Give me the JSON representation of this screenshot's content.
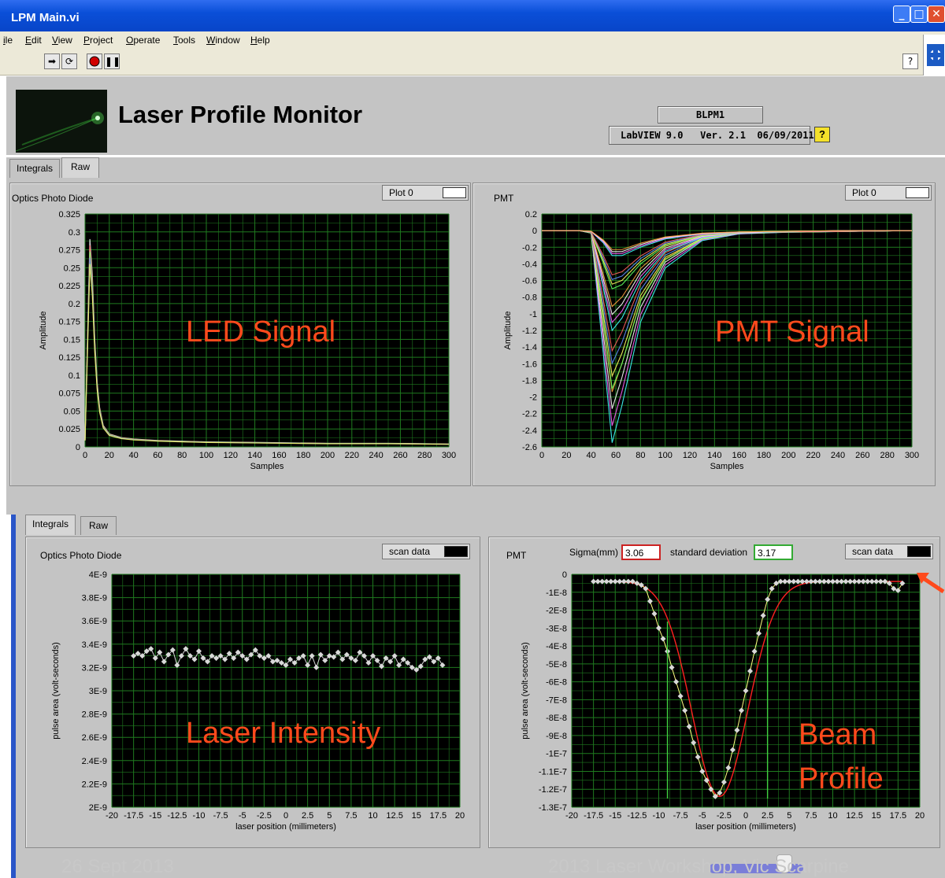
{
  "window": {
    "title": "LPM Main.vi"
  },
  "menu": [
    "ile",
    "Edit",
    "View",
    "Project",
    "Operate",
    "Tools",
    "Window",
    "Help"
  ],
  "toolbar": {
    "run_icon": "run-arrow-icon",
    "run_continuous_icon": "run-continuous-icon",
    "abort_icon": "abort-icon",
    "pause_icon": "pause-icon",
    "help_label": "?"
  },
  "header": {
    "title": "Laser Profile Monitor",
    "device": "BLPM1",
    "software": "LabVIEW 9.0",
    "version": "Ver. 2.1  06/09/2011",
    "help_label": "?"
  },
  "top_tabs": [
    "Integrals",
    "Raw"
  ],
  "top_active_tab": "Raw",
  "bottom_tabs": [
    "Integrals",
    "Raw"
  ],
  "bottom_active_tab": "Integrals",
  "overlays": {
    "led": "LED Signal",
    "pmt": "PMT Signal",
    "laser": "Laser Intensity",
    "beam1": "Beam",
    "beam2": "Profile"
  },
  "pmt_stats": {
    "sigma_label": "Sigma(mm)",
    "sigma_value": "3.06",
    "std_label": "standard deviation",
    "std_value": "3.17"
  },
  "footer": {
    "date": "26 Sept 2013",
    "event": "2013 Laser Workshop, Vic Scarpine"
  },
  "colors": {
    "plot_bg": "#000000",
    "grid": "#1f7a1f",
    "panel": "#c4c4c4",
    "overlay_text": "#ff4a1c",
    "fit_line": "#ff2020",
    "markers": "#d8d8d8",
    "sigma_border": "#cc2222",
    "std_border": "#33aa33",
    "cursor": "#40d040"
  },
  "chart_data": [
    {
      "type": "line",
      "title": "Optics Photo Diode",
      "legend": "Plot 0",
      "xlabel": "Samples",
      "ylabel": "Amplitude",
      "xlim": [
        0,
        300
      ],
      "ylim": [
        0,
        0.325
      ],
      "x_ticks": [
        "0",
        "20",
        "40",
        "60",
        "80",
        "100",
        "120",
        "140",
        "160",
        "180",
        "200",
        "220",
        "240",
        "260",
        "280",
        "300"
      ],
      "y_ticks": [
        "0",
        "0.025",
        "0.05",
        "0.075",
        "0.1",
        "0.125",
        "0.15",
        "0.175",
        "0.2",
        "0.225",
        "0.25",
        "0.275",
        "0.3",
        "0.325"
      ],
      "series": [
        {
          "x": [
            0,
            2,
            4,
            6,
            8,
            10,
            12,
            15,
            20,
            30,
            40,
            60,
            80,
            100,
            150,
            200,
            250,
            300
          ],
          "y": [
            0.01,
            0.15,
            0.29,
            0.24,
            0.15,
            0.09,
            0.055,
            0.03,
            0.018,
            0.013,
            0.011,
            0.009,
            0.008,
            0.007,
            0.006,
            0.005,
            0.005,
            0.004
          ]
        }
      ]
    },
    {
      "type": "line",
      "title": "PMT",
      "legend": "Plot 0",
      "xlabel": "Samples",
      "ylabel": "Amplitude",
      "xlim": [
        0,
        300
      ],
      "ylim": [
        -2.6,
        0.2
      ],
      "x_ticks": [
        "0",
        "20",
        "40",
        "60",
        "80",
        "100",
        "120",
        "140",
        "160",
        "180",
        "200",
        "220",
        "240",
        "260",
        "280",
        "300"
      ],
      "y_ticks": [
        "0.2",
        "0",
        "-0.2",
        "-0.4",
        "-0.6",
        "-0.8",
        "-1",
        "-1.2",
        "-1.4",
        "-1.6",
        "-1.8",
        "-2",
        "-2.2",
        "-2.4",
        "-2.6"
      ],
      "series": [
        {
          "x": [
            0,
            30,
            40,
            50,
            57,
            65,
            80,
            100,
            130,
            160,
            200,
            250,
            300
          ],
          "y": [
            0,
            0,
            -0.03,
            -1.5,
            -2.55,
            -2.1,
            -1.1,
            -0.45,
            -0.12,
            -0.04,
            -0.02,
            -0.01,
            0
          ]
        },
        {
          "x": [
            0,
            30,
            40,
            50,
            57,
            65,
            80,
            100,
            130,
            160,
            200,
            250,
            300
          ],
          "y": [
            0,
            0,
            -0.03,
            -1.1,
            -1.9,
            -1.6,
            -0.85,
            -0.35,
            -0.1,
            -0.03,
            -0.02,
            -0.01,
            0
          ]
        },
        {
          "x": [
            0,
            30,
            40,
            50,
            57,
            65,
            80,
            100,
            130,
            160,
            200,
            250,
            300
          ],
          "y": [
            0,
            0,
            -0.02,
            -0.7,
            -1.2,
            -1.05,
            -0.6,
            -0.25,
            -0.08,
            -0.03,
            -0.01,
            0,
            0
          ]
        },
        {
          "x": [
            0,
            30,
            40,
            50,
            57,
            65,
            80,
            100,
            130,
            160,
            200,
            250,
            300
          ],
          "y": [
            0,
            0,
            -0.02,
            -0.4,
            -0.7,
            -0.65,
            -0.4,
            -0.18,
            -0.06,
            -0.02,
            -0.01,
            0,
            0
          ]
        },
        {
          "x": [
            0,
            30,
            40,
            50,
            57,
            65,
            80,
            100,
            130,
            160,
            200,
            250,
            300
          ],
          "y": [
            0,
            0,
            -0.01,
            -0.15,
            -0.3,
            -0.3,
            -0.2,
            -0.1,
            -0.04,
            -0.02,
            -0.01,
            0,
            0
          ]
        }
      ]
    },
    {
      "type": "scatter",
      "title": "Optics Photo Diode",
      "legend": "scan data",
      "xlabel": "laser position (millimeters)",
      "ylabel": "pulse area (volt-seconds)",
      "xlim": [
        -20,
        20
      ],
      "ylim": [
        2e-09,
        4e-09
      ],
      "x_ticks": [
        "-20",
        "-17.5",
        "-15",
        "-12.5",
        "-10",
        "-7.5",
        "-5",
        "-2.5",
        "0",
        "2.5",
        "5",
        "7.5",
        "10",
        "12.5",
        "15",
        "17.5",
        "20"
      ],
      "y_ticks": [
        "2E-9",
        "2.2E-9",
        "2.4E-9",
        "2.6E-9",
        "2.8E-9",
        "3E-9",
        "3.2E-9",
        "3.4E-9",
        "3.6E-9",
        "3.8E-9",
        "4E-9"
      ],
      "x": [
        -17.5,
        -17,
        -16.5,
        -16,
        -15.5,
        -15,
        -14.5,
        -14,
        -13.5,
        -13,
        -12.5,
        -12,
        -11.5,
        -11,
        -10.5,
        -10,
        -9.5,
        -9,
        -8.5,
        -8,
        -7.5,
        -7,
        -6.5,
        -6,
        -5.5,
        -5,
        -4.5,
        -4,
        -3.5,
        -3,
        -2.5,
        -2,
        -1.5,
        -1,
        -0.5,
        0,
        0.5,
        1,
        1.5,
        2,
        2.5,
        3,
        3.5,
        4,
        4.5,
        5,
        5.5,
        6,
        6.5,
        7,
        7.5,
        8,
        8.5,
        9,
        9.5,
        10,
        10.5,
        11,
        11.5,
        12,
        12.5,
        13,
        13.5,
        14,
        14.5,
        15,
        15.5,
        16,
        16.5,
        17,
        17.5,
        18
      ],
      "y": [
        3.3e-09,
        3.32e-09,
        3.3e-09,
        3.34e-09,
        3.36e-09,
        3.28e-09,
        3.33e-09,
        3.25e-09,
        3.31e-09,
        3.35e-09,
        3.22e-09,
        3.3e-09,
        3.36e-09,
        3.3e-09,
        3.27e-09,
        3.34e-09,
        3.28e-09,
        3.25e-09,
        3.3e-09,
        3.28e-09,
        3.3e-09,
        3.27e-09,
        3.32e-09,
        3.28e-09,
        3.33e-09,
        3.3e-09,
        3.27e-09,
        3.31e-09,
        3.35e-09,
        3.3e-09,
        3.28e-09,
        3.3e-09,
        3.25e-09,
        3.26e-09,
        3.24e-09,
        3.22e-09,
        3.27e-09,
        3.24e-09,
        3.28e-09,
        3.3e-09,
        3.22e-09,
        3.3e-09,
        3.2e-09,
        3.31e-09,
        3.26e-09,
        3.3e-09,
        3.29e-09,
        3.33e-09,
        3.27e-09,
        3.31e-09,
        3.28e-09,
        3.26e-09,
        3.33e-09,
        3.3e-09,
        3.24e-09,
        3.3e-09,
        3.26e-09,
        3.21e-09,
        3.28e-09,
        3.25e-09,
        3.3e-09,
        3.22e-09,
        3.27e-09,
        3.24e-09,
        3.2e-09,
        3.18e-09,
        3.21e-09,
        3.27e-09,
        3.29e-09,
        3.25e-09,
        3.28e-09,
        3.22e-09
      ]
    },
    {
      "type": "scatter",
      "title": "PMT",
      "legend": "scan data",
      "xlabel": "laser position (millimeters)",
      "ylabel": "pulse area (volt-seconds)",
      "xlim": [
        -20,
        20
      ],
      "ylim": [
        -1.3e-07,
        0
      ],
      "x_ticks": [
        "-20",
        "-17.5",
        "-15",
        "-12.5",
        "-10",
        "-7.5",
        "-5",
        "-2.5",
        "0",
        "2.5",
        "5",
        "7.5",
        "10",
        "12.5",
        "15",
        "17.5",
        "20"
      ],
      "y_ticks": [
        "0",
        "-1E-8",
        "-2E-8",
        "-3E-8",
        "-4E-8",
        "-5E-8",
        "-6E-8",
        "-7E-8",
        "-8E-8",
        "-9E-8",
        "-1E-7",
        "-1.1E-7",
        "-1.2E-7",
        "-1.3E-7"
      ],
      "x": [
        -17.5,
        -17,
        -16.5,
        -16,
        -15.5,
        -15,
        -14.5,
        -14,
        -13.5,
        -13,
        -12.5,
        -12,
        -11.5,
        -11,
        -10.5,
        -10,
        -9.5,
        -9,
        -8.5,
        -8,
        -7.5,
        -7,
        -6.5,
        -6,
        -5.5,
        -5,
        -4.5,
        -4,
        -3.5,
        -3,
        -2.5,
        -2,
        -1.5,
        -1,
        -0.5,
        0,
        0.5,
        1,
        1.5,
        2,
        2.5,
        3,
        3.5,
        4,
        4.5,
        5,
        5.5,
        6,
        6.5,
        7,
        7.5,
        8,
        8.5,
        9,
        9.5,
        10,
        10.5,
        11,
        11.5,
        12,
        12.5,
        13,
        13.5,
        14,
        14.5,
        15,
        15.5,
        16,
        16.5,
        17,
        17.5,
        18
      ],
      "y": [
        -4e-09,
        -4e-09,
        -4e-09,
        -4e-09,
        -4e-09,
        -4e-09,
        -4e-09,
        -4e-09,
        -4e-09,
        -4e-09,
        -5e-09,
        -6e-09,
        -8e-09,
        -1.5e-08,
        -2.2e-08,
        -3e-08,
        -3.6e-08,
        -4.3e-08,
        -5.2e-08,
        -6e-08,
        -6.8e-08,
        -7.6e-08,
        -8.5e-08,
        -9.4e-08,
        -1.02e-07,
        -1.1e-07,
        -1.15e-07,
        -1.2e-07,
        -1.24e-07,
        -1.22e-07,
        -1.16e-07,
        -1.08e-07,
        -9.8e-08,
        -8.7e-08,
        -7.6e-08,
        -6.5e-08,
        -5.4e-08,
        -4.3e-08,
        -3.3e-08,
        -2.3e-08,
        -1.4e-08,
        -8e-09,
        -5e-09,
        -4e-09,
        -4e-09,
        -4e-09,
        -4e-09,
        -4e-09,
        -4e-09,
        -4e-09,
        -4e-09,
        -4e-09,
        -4e-09,
        -4e-09,
        -4e-09,
        -4e-09,
        -4e-09,
        -4e-09,
        -4e-09,
        -4e-09,
        -4e-09,
        -4e-09,
        -4e-09,
        -4e-09,
        -4e-09,
        -4e-09,
        -4e-09,
        -4e-09,
        -5e-09,
        -8e-09,
        -9e-09,
        -5e-09
      ],
      "cursors_x": [
        -9,
        2.5
      ]
    }
  ]
}
